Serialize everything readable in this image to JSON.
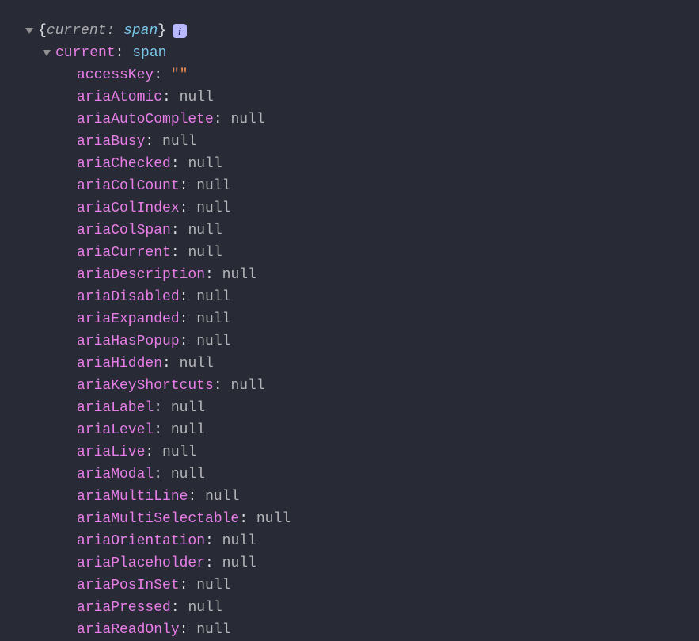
{
  "root": {
    "brace_open": "{",
    "brace_close": "}",
    "preview_key": "current",
    "preview_colon": ":",
    "preview_value": "span",
    "info_char": "i"
  },
  "level1": {
    "key": "current",
    "colon": ":",
    "value": "span"
  },
  "props": [
    {
      "key": "accessKey",
      "value": "\"\"",
      "type": "str"
    },
    {
      "key": "ariaAtomic",
      "value": "null",
      "type": "null"
    },
    {
      "key": "ariaAutoComplete",
      "value": "null",
      "type": "null"
    },
    {
      "key": "ariaBusy",
      "value": "null",
      "type": "null"
    },
    {
      "key": "ariaChecked",
      "value": "null",
      "type": "null"
    },
    {
      "key": "ariaColCount",
      "value": "null",
      "type": "null"
    },
    {
      "key": "ariaColIndex",
      "value": "null",
      "type": "null"
    },
    {
      "key": "ariaColSpan",
      "value": "null",
      "type": "null"
    },
    {
      "key": "ariaCurrent",
      "value": "null",
      "type": "null"
    },
    {
      "key": "ariaDescription",
      "value": "null",
      "type": "null"
    },
    {
      "key": "ariaDisabled",
      "value": "null",
      "type": "null"
    },
    {
      "key": "ariaExpanded",
      "value": "null",
      "type": "null"
    },
    {
      "key": "ariaHasPopup",
      "value": "null",
      "type": "null"
    },
    {
      "key": "ariaHidden",
      "value": "null",
      "type": "null"
    },
    {
      "key": "ariaKeyShortcuts",
      "value": "null",
      "type": "null"
    },
    {
      "key": "ariaLabel",
      "value": "null",
      "type": "null"
    },
    {
      "key": "ariaLevel",
      "value": "null",
      "type": "null"
    },
    {
      "key": "ariaLive",
      "value": "null",
      "type": "null"
    },
    {
      "key": "ariaModal",
      "value": "null",
      "type": "null"
    },
    {
      "key": "ariaMultiLine",
      "value": "null",
      "type": "null"
    },
    {
      "key": "ariaMultiSelectable",
      "value": "null",
      "type": "null"
    },
    {
      "key": "ariaOrientation",
      "value": "null",
      "type": "null"
    },
    {
      "key": "ariaPlaceholder",
      "value": "null",
      "type": "null"
    },
    {
      "key": "ariaPosInSet",
      "value": "null",
      "type": "null"
    },
    {
      "key": "ariaPressed",
      "value": "null",
      "type": "null"
    },
    {
      "key": "ariaReadOnly",
      "value": "null",
      "type": "null"
    }
  ]
}
